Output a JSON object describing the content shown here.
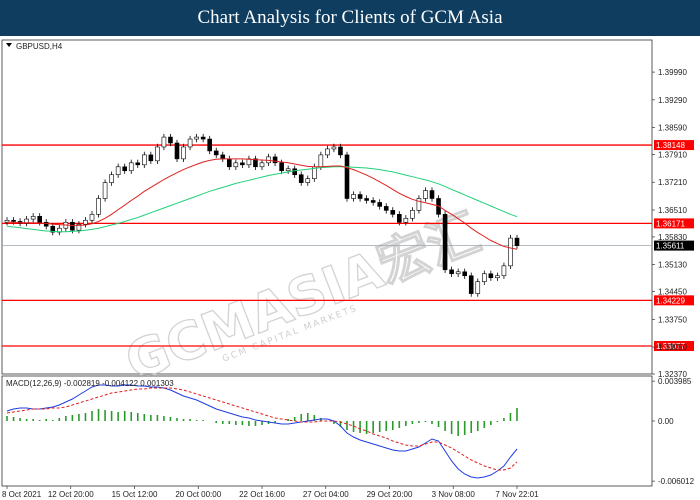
{
  "header": {
    "title": "Chart Analysis for Clients of GCM Asia"
  },
  "watermark": {
    "text": "GCMASIA宏汇",
    "subtext": "GCM CAPITAL MARKETS"
  },
  "chart_data": [
    {
      "type": "candlestick",
      "symbol_label": "GBPUSD,H4",
      "ylim": [
        1.3237,
        1.408
      ],
      "yticks": [
        "1.39990",
        "1.39290",
        "1.38590",
        "1.37910",
        "1.37210",
        "1.36510",
        "1.35830",
        "1.35130",
        "1.34450",
        "1.33750",
        "1.33050",
        "1.32370"
      ],
      "horizontal_levels": [
        {
          "value": 1.38148,
          "label": "1.38148",
          "color": "#ff0000"
        },
        {
          "value": 1.36171,
          "label": "1.36171",
          "color": "#ff0000"
        },
        {
          "value": 1.34229,
          "label": "1.34229",
          "color": "#ff0000"
        },
        {
          "value": 1.33077,
          "label": "1.33077",
          "color": "#ff0000"
        }
      ],
      "current_price": {
        "value": 1.35611,
        "label": "1.35611",
        "color": "#000000"
      },
      "close": [
        1.3625,
        1.3622,
        1.3618,
        1.3628,
        1.3635,
        1.362,
        1.361,
        1.3595,
        1.3605,
        1.362,
        1.36,
        1.3615,
        1.3625,
        1.364,
        1.368,
        1.372,
        1.374,
        1.376,
        1.375,
        1.377,
        1.3765,
        1.379,
        1.3775,
        1.381,
        1.3835,
        1.382,
        1.378,
        1.381,
        1.383,
        1.3835,
        1.383,
        1.38,
        1.379,
        1.378,
        1.376,
        1.377,
        1.3765,
        1.378,
        1.376,
        1.377,
        1.3785,
        1.377,
        1.375,
        1.3755,
        1.374,
        1.372,
        1.373,
        1.376,
        1.379,
        1.3805,
        1.381,
        1.379,
        1.368,
        1.369,
        1.368,
        1.3675,
        1.367,
        1.366,
        1.365,
        1.364,
        1.362,
        1.363,
        1.365,
        1.368,
        1.37,
        1.368,
        1.364,
        1.35,
        1.349,
        1.3495,
        1.3485,
        1.344,
        1.347,
        1.349,
        1.348,
        1.3485,
        1.351,
        1.358,
        1.3561
      ],
      "ma_red": [
        1.362,
        1.362,
        1.3619,
        1.3619,
        1.3619,
        1.3618,
        1.3617,
        1.3615,
        1.3614,
        1.3613,
        1.3612,
        1.3612,
        1.3613,
        1.3616,
        1.3622,
        1.363,
        1.364,
        1.3652,
        1.3663,
        1.3675,
        1.3686,
        1.3698,
        1.3708,
        1.3718,
        1.3728,
        1.3737,
        1.3745,
        1.3753,
        1.376,
        1.3766,
        1.3772,
        1.3776,
        1.3779,
        1.378,
        1.378,
        1.378,
        1.378,
        1.3779,
        1.3778,
        1.3777,
        1.3776,
        1.3774,
        1.3772,
        1.377,
        1.3767,
        1.3764,
        1.3761,
        1.376,
        1.376,
        1.3761,
        1.3762,
        1.3762,
        1.3758,
        1.3753,
        1.3746,
        1.3739,
        1.3731,
        1.3722,
        1.3713,
        1.3703,
        1.3693,
        1.3685,
        1.3678,
        1.3673,
        1.3669,
        1.3665,
        1.3661,
        1.365,
        1.364,
        1.3629,
        1.3618,
        1.3605,
        1.3594,
        1.3584,
        1.3574,
        1.3566,
        1.3559,
        1.3555,
        1.3552
      ],
      "ma_green": [
        1.361,
        1.3608,
        1.3606,
        1.3604,
        1.3602,
        1.36,
        1.3598,
        1.3597,
        1.3596,
        1.3596,
        1.3597,
        1.3598,
        1.36,
        1.3602,
        1.3605,
        1.3609,
        1.3613,
        1.3617,
        1.3622,
        1.3627,
        1.3632,
        1.3638,
        1.3644,
        1.365,
        1.3656,
        1.3662,
        1.3668,
        1.3674,
        1.368,
        1.3686,
        1.3692,
        1.3698,
        1.3703,
        1.3708,
        1.3713,
        1.3718,
        1.3722,
        1.3726,
        1.373,
        1.3734,
        1.3738,
        1.3741,
        1.3744,
        1.3747,
        1.375,
        1.3752,
        1.3754,
        1.3756,
        1.3758,
        1.3759,
        1.376,
        1.376,
        1.376,
        1.3759,
        1.3758,
        1.3757,
        1.3755,
        1.3753,
        1.375,
        1.3747,
        1.3743,
        1.3739,
        1.3735,
        1.3731,
        1.3727,
        1.3722,
        1.3717,
        1.371,
        1.3703,
        1.3696,
        1.3689,
        1.3682,
        1.3675,
        1.3668,
        1.3661,
        1.3654,
        1.3647,
        1.364,
        1.3634
      ],
      "ma_colors": {
        "red": "#e02020",
        "green": "#1fd17a"
      }
    },
    {
      "type": "macd",
      "label": "MACD(12,26,9) -0.002819 -0.004122 0.001303",
      "ylim": [
        -0.0065,
        0.0045
      ],
      "yticks": [
        {
          "value": 0.003985,
          "label": "0.003985"
        },
        {
          "value": 0.0,
          "label": "0.00"
        },
        {
          "value": -0.006012,
          "label": "-0.006012"
        }
      ],
      "histogram": [
        0.0005,
        0.0004,
        0.0003,
        0.0002,
        0.0002,
        0.0001,
        0.0002,
        0.0001,
        0.0003,
        0.0005,
        0.0006,
        0.0007,
        0.0008,
        0.001,
        0.0012,
        0.0011,
        0.001,
        0.0009,
        0.001,
        0.0009,
        0.0008,
        0.0007,
        0.0006,
        0.0006,
        0.0005,
        0.0004,
        0.0003,
        0.0002,
        0.0002,
        0.0001,
        0.0001,
        0.0,
        -0.0002,
        -0.0003,
        -0.0003,
        -0.0004,
        -0.0004,
        -0.0005,
        -0.0005,
        -0.0004,
        -0.0003,
        -0.0002,
        0.0,
        0.0002,
        0.0004,
        0.0007,
        0.0008,
        0.0006,
        0.0003,
        0.0,
        -0.0003,
        -0.0006,
        -0.0009,
        -0.0011,
        -0.0012,
        -0.0013,
        -0.0012,
        -0.0011,
        -0.001,
        -0.0009,
        -0.0007,
        -0.0005,
        -0.0003,
        -0.0002,
        -0.0001,
        -0.0003,
        -0.0006,
        -0.001,
        -0.0013,
        -0.0015,
        -0.0014,
        -0.0012,
        -0.001,
        -0.0007,
        -0.0004,
        -0.0001,
        0.0003,
        0.0008,
        0.0013
      ],
      "macd_line": [
        0.001,
        0.0012,
        0.0013,
        0.0013,
        0.0012,
        0.0012,
        0.0013,
        0.0014,
        0.0016,
        0.0019,
        0.0022,
        0.0026,
        0.003,
        0.0034,
        0.0036,
        0.0036,
        0.0035,
        0.0035,
        0.0036,
        0.0036,
        0.0035,
        0.0035,
        0.0034,
        0.0034,
        0.0033,
        0.0031,
        0.0028,
        0.0025,
        0.0023,
        0.0021,
        0.0018,
        0.0015,
        0.0012,
        0.001,
        0.0008,
        0.0006,
        0.0004,
        0.0003,
        0.0001,
        0.0,
        -0.0001,
        -0.0002,
        -0.0003,
        -0.0003,
        -0.0002,
        -0.0001,
        0.0,
        0.0001,
        0.0002,
        0.0002,
        0.0,
        -0.0005,
        -0.0012,
        -0.0016,
        -0.0019,
        -0.0021,
        -0.0023,
        -0.0025,
        -0.0027,
        -0.0029,
        -0.003,
        -0.003,
        -0.0028,
        -0.0026,
        -0.0022,
        -0.0018,
        -0.002,
        -0.003,
        -0.004,
        -0.0048,
        -0.0053,
        -0.0056,
        -0.0057,
        -0.0056,
        -0.0054,
        -0.005,
        -0.0045,
        -0.0036,
        -0.0028
      ],
      "signal_line": [
        0.0008,
        0.0009,
        0.001,
        0.0011,
        0.0012,
        0.0012,
        0.0012,
        0.0013,
        0.0013,
        0.0014,
        0.0016,
        0.0018,
        0.002,
        0.0022,
        0.0024,
        0.0026,
        0.0028,
        0.0029,
        0.003,
        0.0031,
        0.0032,
        0.0032,
        0.0033,
        0.0033,
        0.0033,
        0.0033,
        0.0032,
        0.0031,
        0.0029,
        0.0027,
        0.0025,
        0.0023,
        0.0021,
        0.0019,
        0.0017,
        0.0015,
        0.0013,
        0.0011,
        0.0009,
        0.0007,
        0.0005,
        0.0003,
        0.0002,
        0.0001,
        0.0,
        -0.0001,
        -0.0001,
        -0.0001,
        0.0,
        0.0,
        0.0,
        -0.0001,
        -0.0003,
        -0.0005,
        -0.0008,
        -0.001,
        -0.0013,
        -0.0015,
        -0.0017,
        -0.002,
        -0.0022,
        -0.0024,
        -0.0025,
        -0.0025,
        -0.0023,
        -0.0021,
        -0.0021,
        -0.0024,
        -0.0027,
        -0.0031,
        -0.0035,
        -0.0039,
        -0.0042,
        -0.0045,
        -0.0047,
        -0.0049,
        -0.0049,
        -0.0047,
        -0.0041
      ],
      "colors": {
        "macd": "#1e3de0",
        "signal": "#e02020",
        "histogram": "#2a9a2a"
      }
    }
  ],
  "x_axis": {
    "labels": [
      "8 Oct 2021",
      "12 Oct 20:00",
      "15 Oct 12:00",
      "20 Oct 00:00",
      "22 Oct 16:00",
      "27 Oct 04:00",
      "29 Oct 20:00",
      "3 Nov 08:00",
      "7 Nov 22:01"
    ]
  }
}
